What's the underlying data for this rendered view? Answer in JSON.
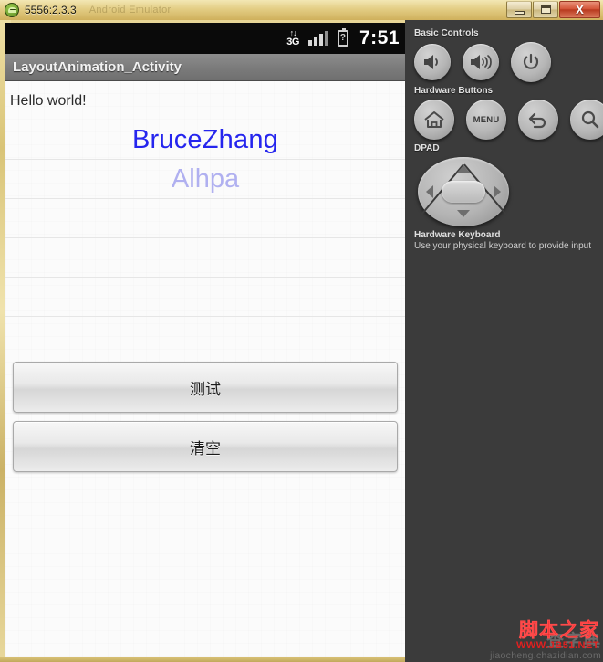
{
  "window": {
    "title": "5556:2.3.3",
    "ghost_title": "Android Emulator",
    "icon": "android-robot-icon",
    "buttons": {
      "minimize": "minimize-icon",
      "maximize": "maximize-icon",
      "close_label": "X"
    }
  },
  "statusbar": {
    "network_arrows": "↑↓",
    "network_label": "3G",
    "signal": "signal-bars-icon",
    "battery": "?",
    "time": "7:51"
  },
  "app": {
    "title": "LayoutAnimation_Activity",
    "rows": [
      {
        "text": "Hello world!",
        "style": "hello"
      },
      {
        "text": "BruceZhang",
        "style": "brucezhang",
        "color": "#2525ee"
      },
      {
        "text": "Alhpa",
        "style": "alhpa",
        "color": "#b0b0f0"
      },
      {
        "text": "",
        "style": "empty"
      },
      {
        "text": "",
        "style": "empty"
      },
      {
        "text": "",
        "style": "empty"
      },
      {
        "text": "",
        "style": "empty"
      }
    ],
    "buttons": [
      {
        "label": "测试",
        "name": "test-button"
      },
      {
        "label": "清空",
        "name": "clear-button"
      }
    ]
  },
  "panel": {
    "basic_controls": {
      "heading": "Basic Controls",
      "buttons": [
        {
          "name": "volume-down-icon",
          "label": "Volume Down"
        },
        {
          "name": "volume-up-icon",
          "label": "Volume Up"
        },
        {
          "name": "power-icon",
          "label": "Power"
        }
      ]
    },
    "hardware_buttons": {
      "heading": "Hardware Buttons",
      "buttons": [
        {
          "name": "home-icon",
          "label": "Home"
        },
        {
          "name": "menu-button",
          "label": "MENU"
        },
        {
          "name": "back-icon",
          "label": "Back"
        },
        {
          "name": "search-icon",
          "label": "Search"
        }
      ]
    },
    "dpad": {
      "heading": "DPAD",
      "directions": [
        "up",
        "down",
        "left",
        "right",
        "center"
      ]
    },
    "keyboard": {
      "title": "Hardware Keyboard",
      "description": "Use your physical keyboard to provide input"
    }
  },
  "watermark": {
    "gray_main": "查字典",
    "gray_sub": "jiaocheng.chazidian.com",
    "red_main": "脚本之家",
    "red_sub": "WWW.JB51.NET"
  }
}
